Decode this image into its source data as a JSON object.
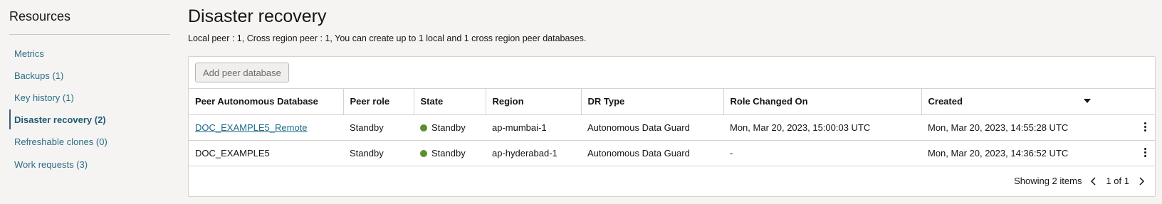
{
  "sidebar": {
    "title": "Resources",
    "items": [
      {
        "label": "Metrics"
      },
      {
        "label": "Backups (1)"
      },
      {
        "label": "Key history (1)"
      },
      {
        "label": "Disaster recovery (2)"
      },
      {
        "label": "Refreshable clones (0)"
      },
      {
        "label": "Work requests (3)"
      }
    ],
    "active_index": 3
  },
  "main": {
    "title": "Disaster recovery",
    "summary": "Local peer : 1, Cross region peer : 1, You can create up to 1 local and 1 cross region peer databases.",
    "add_button": "Add peer database",
    "columns": [
      "Peer Autonomous Database",
      "Peer role",
      "State",
      "Region",
      "DR Type",
      "Role Changed On",
      "Created"
    ],
    "rows": [
      {
        "name": "DOC_EXAMPLE5_Remote",
        "is_link": true,
        "role": "Standby",
        "state": "Standby",
        "region": "ap-mumbai-1",
        "dr_type": "Autonomous Data Guard",
        "role_changed": "Mon, Mar 20, 2023, 15:00:03 UTC",
        "created": "Mon, Mar 20, 2023, 14:55:28 UTC"
      },
      {
        "name": "DOC_EXAMPLE5",
        "is_link": false,
        "role": "Standby",
        "state": "Standby",
        "region": "ap-hyderabad-1",
        "dr_type": "Autonomous Data Guard",
        "role_changed": "-",
        "created": "Mon, Mar 20, 2023, 14:36:52 UTC"
      }
    ],
    "footer": {
      "showing": "Showing 2 items",
      "page": "1 of 1"
    }
  },
  "colors": {
    "link": "#1d6a8d",
    "state_available": "#5b8f2e",
    "active_nav": "#1f5c74"
  },
  "icons": {
    "state": "status-dot-icon",
    "actions": "kebab-icon",
    "sort": "sort-caret-icon",
    "prev": "chevron-left-icon",
    "next": "chevron-right-icon"
  }
}
